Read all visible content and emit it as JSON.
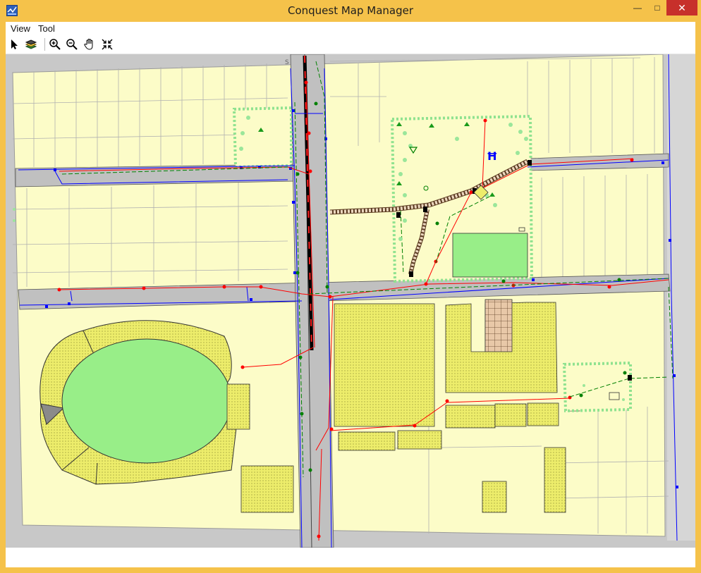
{
  "window": {
    "title": "Conquest Map Manager",
    "minimize_icon": "minimize-icon",
    "maximize_icon": "maximize-icon",
    "close_icon": "close-icon"
  },
  "menu": {
    "items": [
      {
        "label": "View"
      },
      {
        "label": "Tool"
      }
    ]
  },
  "toolbar": {
    "tools": [
      {
        "icon": "select-arrow-icon"
      },
      {
        "icon": "layers-icon"
      },
      {
        "icon": "zoom-in-icon"
      },
      {
        "icon": "zoom-out-icon"
      },
      {
        "icon": "pan-hand-icon"
      },
      {
        "icon": "zoom-extents-icon"
      }
    ]
  },
  "map": {
    "north_marker": "S",
    "colors": {
      "parcel_fill": "#fcfcc8",
      "road": "#c0c0c0",
      "park": "#98ee88",
      "building": "#eded6b",
      "water_line": "#0000ff",
      "sewer_line": "#ff0000",
      "storm_line": "#008000",
      "rail": "#000000"
    }
  }
}
